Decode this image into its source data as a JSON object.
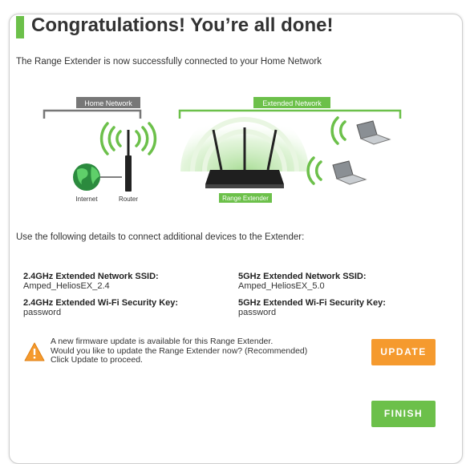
{
  "header": {
    "title": "Congratulations! You’re all done!",
    "subtitle": "The Range Extender is now successfully connected to your Home Network"
  },
  "diagram": {
    "home_network_label": "Home Network",
    "extended_network_label": "Extended Network",
    "internet_label": "Internet",
    "router_label": "Router",
    "range_extender_label": "Range Extender"
  },
  "details": {
    "intro": "Use the following details to connect additional devices to the Extender:",
    "ssid_24_label": "2.4GHz Extended Network SSID:",
    "ssid_24_value": "Amped_HeliosEX_2.4",
    "key_24_label": "2.4GHz Extended Wi-Fi Security Key:",
    "key_24_value": "password",
    "ssid_5_label": "5GHz Extended Network SSID:",
    "ssid_5_value": "Amped_HeliosEX_5.0",
    "key_5_label": "5GHz Extended Wi-Fi Security Key:",
    "key_5_value": "password"
  },
  "firmware": {
    "line1": "A new firmware update is available for this Range Extender.",
    "line2": "Would you like to update the Range Extender now? (Recommended)",
    "line3": "Click Update to proceed.",
    "icon": "warning-icon"
  },
  "buttons": {
    "update": "UPDATE",
    "finish": "FINISH"
  },
  "colors": {
    "accent_green": "#6cc04a",
    "accent_orange": "#f59a2e",
    "home_network_gray": "#777777"
  }
}
